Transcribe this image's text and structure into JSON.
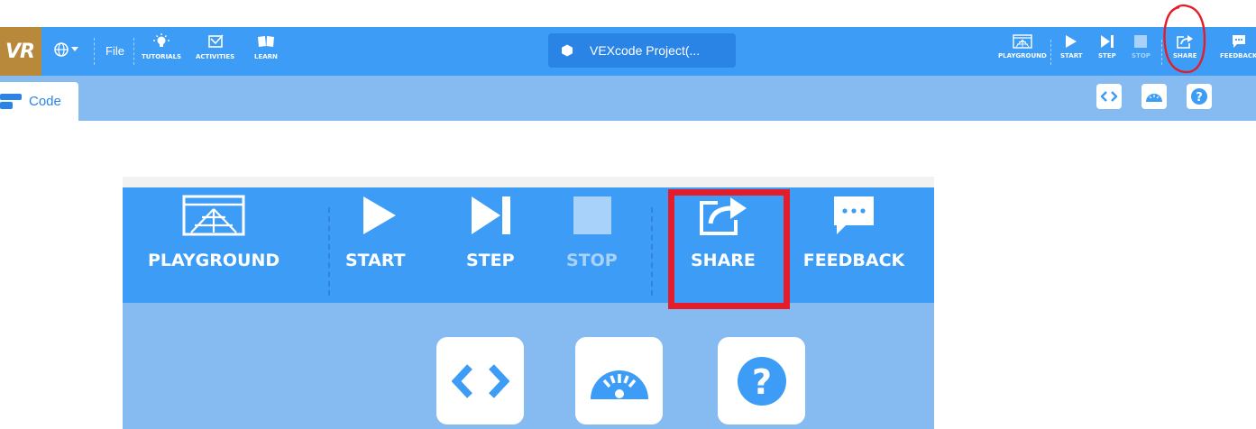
{
  "toolbar": {
    "logo_text": "VR",
    "file_label": "File",
    "nav": [
      {
        "label": "TUTORIALS",
        "icon": "lightbulb-icon"
      },
      {
        "label": "ACTIVITIES",
        "icon": "checkbox-icon"
      },
      {
        "label": "LEARN",
        "icon": "book-icon"
      }
    ],
    "project_title": "VEXcode Project(...",
    "right_buttons": [
      {
        "label": "PLAYGROUND",
        "icon": "playground-icon",
        "enabled": true
      },
      {
        "label": "START",
        "icon": "play-icon",
        "enabled": true
      },
      {
        "label": "STEP",
        "icon": "step-icon",
        "enabled": true
      },
      {
        "label": "STOP",
        "icon": "stop-icon",
        "enabled": false
      },
      {
        "label": "SHARE",
        "icon": "share-icon",
        "enabled": true
      },
      {
        "label": "FEEDBACK",
        "icon": "feedback-icon",
        "enabled": true
      }
    ]
  },
  "tabs": {
    "code_label": "Code",
    "tool_icons": [
      "code-view-icon",
      "dashboard-icon",
      "help-icon"
    ]
  },
  "zoomed": {
    "buttons": [
      {
        "label": "PLAYGROUND"
      },
      {
        "label": "START"
      },
      {
        "label": "STEP"
      },
      {
        "label": "STOP"
      },
      {
        "label": "SHARE"
      },
      {
        "label": "FEEDBACK"
      }
    ]
  },
  "colors": {
    "toolbar_blue": "#3c9cf6",
    "light_blue": "#85bbf1",
    "logo_gold": "#b8893a",
    "annotation_red": "#e51d2a"
  }
}
